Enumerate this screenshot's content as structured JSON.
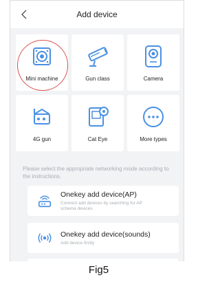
{
  "header": {
    "title": "Add device"
  },
  "devices": [
    {
      "label": "Mini machine",
      "icon": "mini-machine-icon",
      "selected": true
    },
    {
      "label": "Gun class",
      "icon": "gun-camera-icon"
    },
    {
      "label": "Camera",
      "icon": "camera-icon"
    },
    {
      "label": "4G gun",
      "icon": "4g-gun-icon"
    },
    {
      "label": "Cat Eye",
      "icon": "cat-eye-icon"
    },
    {
      "label": "More types",
      "icon": "more-icon"
    }
  ],
  "hint": "Please select the appropriate networking mode according to the instructions.",
  "options": [
    {
      "title": "Onekey add device(AP)",
      "subtitle": "Connect add devices by searching for AP schema devices",
      "icon": "router-icon"
    },
    {
      "title": "Onekey add device(sounds)",
      "subtitle": "Add device firstly",
      "icon": "sound-wave-icon"
    }
  ],
  "caption": "Fig5",
  "colors": {
    "accent": "#4a90e2",
    "selection_ring": "#d9534f"
  }
}
